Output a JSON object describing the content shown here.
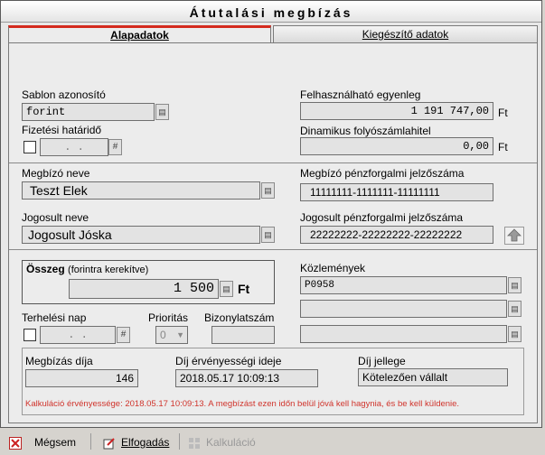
{
  "window": {
    "title": "Átutalási megbízás"
  },
  "tabs": {
    "main": "Alapadatok",
    "extra": "Kiegészítő adatok"
  },
  "template": {
    "label": "Sablon azonosító",
    "value": "forint"
  },
  "due": {
    "label": "Fizetési határidő",
    "value": ". .",
    "hash": "#"
  },
  "balance": {
    "label": "Felhasználható egyenleg",
    "value": "1 191 747,00",
    "unit": "Ft"
  },
  "credit": {
    "label": "Dinamikus folyószámlahitel",
    "value": "0,00",
    "unit": "Ft"
  },
  "payer": {
    "name_label": "Megbízó neve",
    "name_value": "Teszt Elek",
    "acct_label": "Megbízó pénzforgalmi jelzőszáma",
    "acct_value": "11111111-1111111-11111111"
  },
  "payee": {
    "name_label": "Jogosult neve",
    "name_value": "Jogosult Jóska",
    "acct_label": "Jogosult pénzforgalmi jelzőszáma",
    "acct_value": "22222222-22222222-22222222"
  },
  "amount": {
    "label": "Összeg",
    "sublabel": "(forintra kerekítve)",
    "value": "1 500",
    "unit": "Ft"
  },
  "remarks": {
    "label": "Közlemények",
    "line1": "P0958",
    "line2": "",
    "line3": ""
  },
  "debit_day": {
    "label": "Terhelési nap",
    "value": ". .",
    "hash": "#"
  },
  "priority": {
    "label": "Prioritás",
    "value": "0"
  },
  "doc_no": {
    "label": "Bizonylatszám",
    "value": ""
  },
  "fee": {
    "label": "Megbízás díja",
    "value": "146"
  },
  "validity": {
    "label": "Díj érvényességi ideje",
    "value": "2018.05.17 10:09:13"
  },
  "fee_type": {
    "label": "Díj jellege",
    "value": "Kötelezően vállalt"
  },
  "notice": "Kalkuláció érvényessége: 2018.05.17 10:09:13. A megbízást ezen időn belül jóvá kell hagynia, és be kell küldenie.",
  "buttons": {
    "cancel": "Mégsem",
    "accept": "Elfogadás",
    "calc": "Kalkuláció"
  },
  "colors": {
    "accent": "#d42a1e",
    "notice": "#d0342c"
  }
}
